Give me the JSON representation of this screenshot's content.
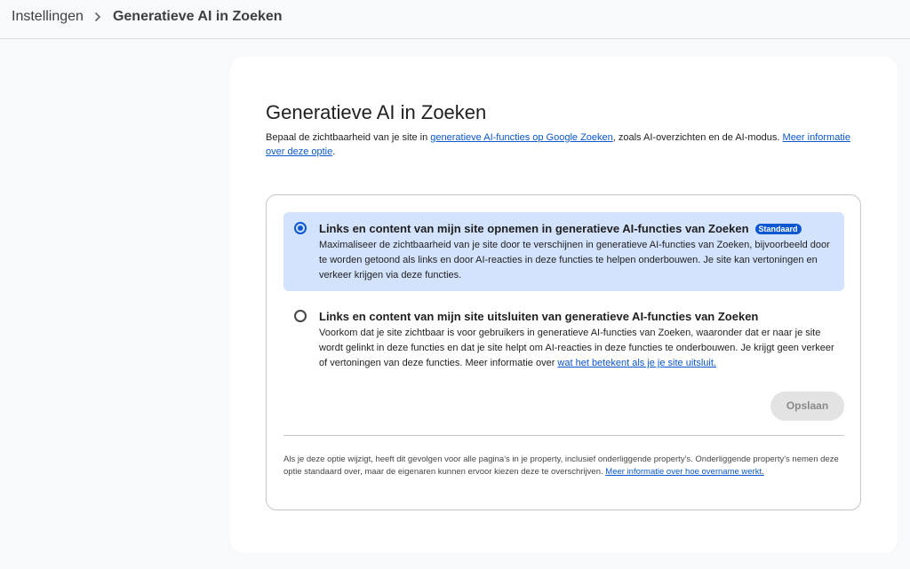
{
  "breadcrumb": {
    "parent": "Instellingen",
    "separator": "›",
    "current": "Generatieve AI in Zoeken"
  },
  "page": {
    "title": "Generatieve AI in Zoeken",
    "description_before": "Bepaal de zichtbaarheid van je site in ",
    "description_link1": "generatieve AI-functies op Google Zoeken",
    "description_middle": ", zoals AI-overzichten en de AI-modus. ",
    "description_link2": "Meer informatie over deze optie",
    "description_after": "."
  },
  "options": [
    {
      "title": "Links en content van mijn site opnemen in generatieve AI-functies van Zoeken",
      "badge": "Standaard",
      "description": "Maximaliseer de zichtbaarheid van je site door te verschijnen in generatieve AI-functies van Zoeken, bijvoorbeeld door te worden getoond als links en door AI-reacties in deze functies te helpen onderbouwen. Je site kan vertoningen en verkeer krijgen via deze functies.",
      "selected": true
    },
    {
      "title": "Links en content van mijn site uitsluiten van generatieve AI-functies van Zoeken",
      "description": "Voorkom dat je site zichtbaar is voor gebruikers in generatieve AI-functies van Zoeken, waaronder dat er naar je site wordt gelinkt in deze functies en dat je site helpt om AI-reacties in deze functies te onderbouwen. Je krijgt geen verkeer of vertoningen van deze functies. Meer informatie over ",
      "link": "wat het betekent als je je site uitsluit.",
      "selected": false
    }
  ],
  "save_label": "Opslaan",
  "footnote": {
    "text": "Als je deze optie wijzigt, heeft dit gevolgen voor alle pagina's in je property, inclusief onderliggende property's. Onderliggende property's nemen deze optie standaard over, maar de eigenaren kunnen ervoor kiezen deze te overschrijven. ",
    "link": "Meer informatie over hoe overname werkt."
  },
  "colors": {
    "accent": "#0b57d0",
    "selected_bg": "#d3e3fd",
    "page_bg": "#f8f9fa",
    "card_bg": "#ffffff"
  },
  "icons": {
    "breadcrumb_separator": "chevron-right-icon"
  }
}
